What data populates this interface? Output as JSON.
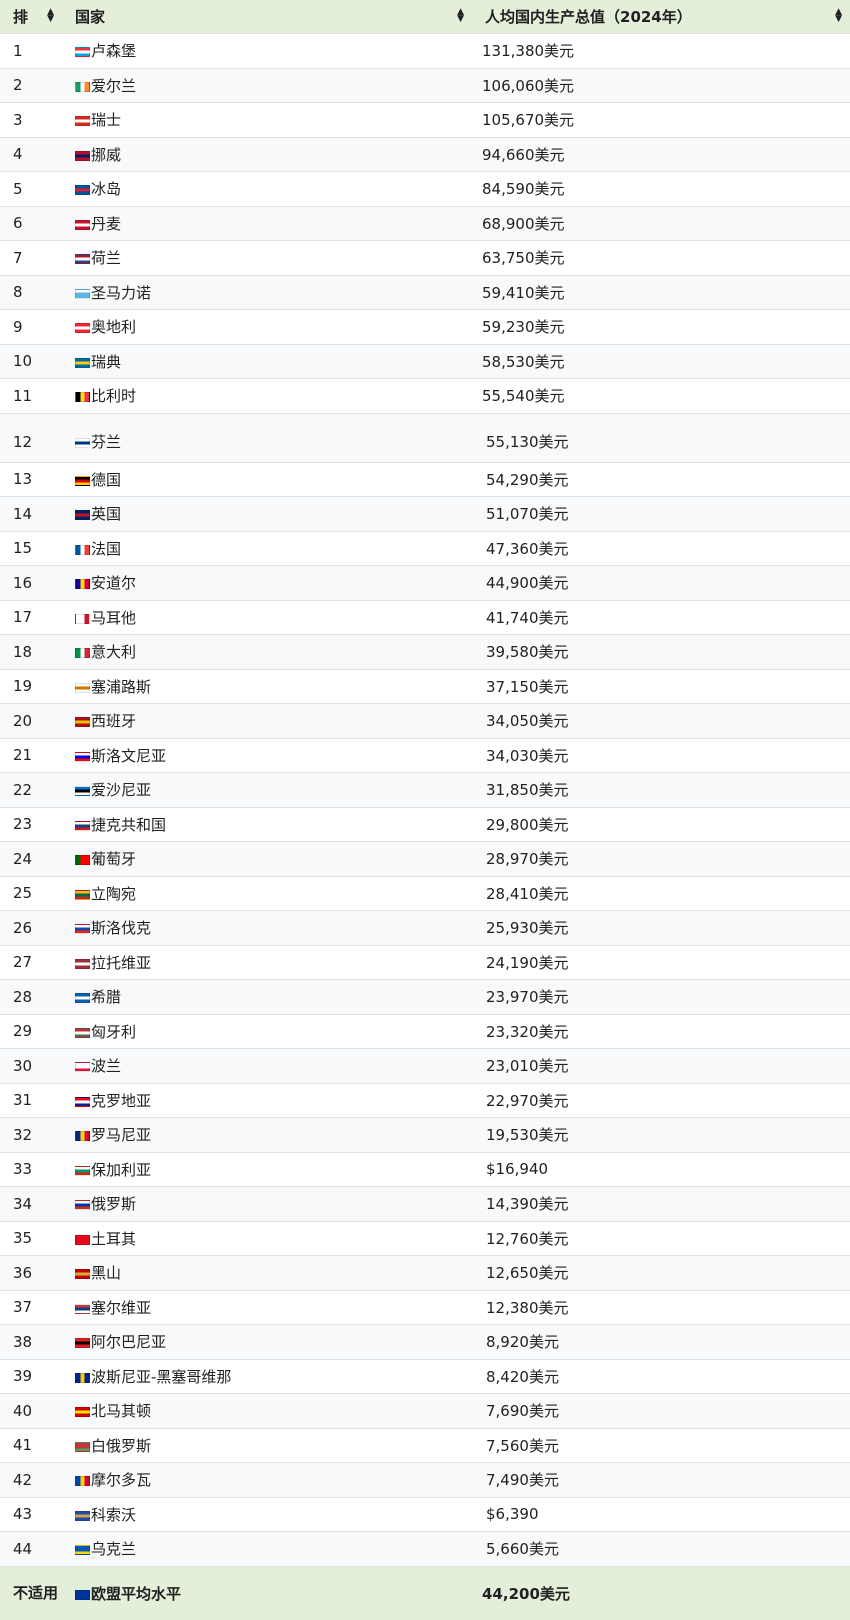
{
  "header": {
    "rank": "排",
    "country": "国家",
    "gdp": "人均国内生产总值（2024年）"
  },
  "rows": [
    {
      "rank": "1",
      "country": "卢森堡",
      "gdp": "131,380美元",
      "flag": [
        "#ef3340",
        "#ffffff",
        "#00a3e0"
      ]
    },
    {
      "rank": "2",
      "country": "爱尔兰",
      "gdp": "106,060美元",
      "flag": [
        "#169b62",
        "#ffffff",
        "#ff883e"
      ],
      "vertical": true
    },
    {
      "rank": "3",
      "country": "瑞士",
      "gdp": "105,670美元",
      "flag": [
        "#d52b1e",
        "#ffffff",
        "#d52b1e"
      ]
    },
    {
      "rank": "4",
      "country": "挪威",
      "gdp": "94,660美元",
      "flag": [
        "#ba0c2f",
        "#00205b",
        "#ba0c2f"
      ]
    },
    {
      "rank": "5",
      "country": "冰岛",
      "gdp": "84,590美元",
      "flag": [
        "#02529c",
        "#dc1e35",
        "#02529c"
      ]
    },
    {
      "rank": "6",
      "country": "丹麦",
      "gdp": "68,900美元",
      "flag": [
        "#c8102e",
        "#ffffff",
        "#c8102e"
      ]
    },
    {
      "rank": "7",
      "country": "荷兰",
      "gdp": "63,750美元",
      "flag": [
        "#ae1c28",
        "#ffffff",
        "#21468b"
      ]
    },
    {
      "rank": "8",
      "country": "圣马力诺",
      "gdp": "59,410美元",
      "flag": [
        "#ffffff",
        "#5eb6e4",
        "#5eb6e4"
      ]
    },
    {
      "rank": "9",
      "country": "奥地利",
      "gdp": "59,230美元",
      "flag": [
        "#ed2939",
        "#ffffff",
        "#ed2939"
      ]
    },
    {
      "rank": "10",
      "country": "瑞典",
      "gdp": "58,530美元",
      "flag": [
        "#006aa7",
        "#fecc00",
        "#006aa7"
      ]
    },
    {
      "rank": "11",
      "country": "比利时",
      "gdp": "55,540美元",
      "flag": [
        "#000000",
        "#fdda24",
        "#ef3340"
      ],
      "vertical": true
    },
    {
      "rank": "12",
      "country": "芬兰",
      "gdp": "55,130美元",
      "flag": [
        "#ffffff",
        "#003580",
        "#ffffff"
      ]
    },
    {
      "rank": "13",
      "country": "德国",
      "gdp": "54,290美元",
      "flag": [
        "#000000",
        "#dd0000",
        "#ffce00"
      ]
    },
    {
      "rank": "14",
      "country": "英国",
      "gdp": "51,070美元",
      "flag": [
        "#012169",
        "#c8102e",
        "#012169"
      ]
    },
    {
      "rank": "15",
      "country": "法国",
      "gdp": "47,360美元",
      "flag": [
        "#0055a4",
        "#ffffff",
        "#ef4135"
      ],
      "vertical": true
    },
    {
      "rank": "16",
      "country": "安道尔",
      "gdp": "44,900美元",
      "flag": [
        "#10069f",
        "#fedd00",
        "#d50032"
      ],
      "vertical": true
    },
    {
      "rank": "17",
      "country": "马耳他",
      "gdp": "41,740美元",
      "flag": [
        "#ffffff",
        "#ffffff",
        "#cf142b"
      ],
      "vertical": true
    },
    {
      "rank": "18",
      "country": "意大利",
      "gdp": "39,580美元",
      "flag": [
        "#009246",
        "#ffffff",
        "#ce2b37"
      ],
      "vertical": true
    },
    {
      "rank": "19",
      "country": "塞浦路斯",
      "gdp": "37,150美元",
      "flag": [
        "#ffffff",
        "#d57800",
        "#ffffff"
      ]
    },
    {
      "rank": "20",
      "country": "西班牙",
      "gdp": "34,050美元",
      "flag": [
        "#aa151b",
        "#f1bf00",
        "#aa151b"
      ]
    },
    {
      "rank": "21",
      "country": "斯洛文尼亚",
      "gdp": "34,030美元",
      "flag": [
        "#ffffff",
        "#0000ff",
        "#ff0000"
      ]
    },
    {
      "rank": "22",
      "country": "爱沙尼亚",
      "gdp": "31,850美元",
      "flag": [
        "#0072ce",
        "#000000",
        "#ffffff"
      ]
    },
    {
      "rank": "23",
      "country": "捷克共和国",
      "gdp": "29,800美元",
      "flag": [
        "#ffffff",
        "#11457e",
        "#d7141a"
      ]
    },
    {
      "rank": "24",
      "country": "葡萄牙",
      "gdp": "28,970美元",
      "flag": [
        "#006600",
        "#ff0000",
        "#ff0000"
      ],
      "vertical": true
    },
    {
      "rank": "25",
      "country": "立陶宛",
      "gdp": "28,410美元",
      "flag": [
        "#fdb913",
        "#006a44",
        "#c1272d"
      ]
    },
    {
      "rank": "26",
      "country": "斯洛伐克",
      "gdp": "25,930美元",
      "flag": [
        "#ffffff",
        "#0b4ea2",
        "#ee1c25"
      ]
    },
    {
      "rank": "27",
      "country": "拉托维亚",
      "gdp": "24,190美元",
      "flag": [
        "#9e3039",
        "#ffffff",
        "#9e3039"
      ]
    },
    {
      "rank": "28",
      "country": "希腊",
      "gdp": "23,970美元",
      "flag": [
        "#0d5eaf",
        "#ffffff",
        "#0d5eaf"
      ]
    },
    {
      "rank": "29",
      "country": "匈牙利",
      "gdp": "23,320美元",
      "flag": [
        "#ce2939",
        "#ffffff",
        "#477050"
      ]
    },
    {
      "rank": "30",
      "country": "波兰",
      "gdp": "23,010美元",
      "flag": [
        "#ffffff",
        "#ffffff",
        "#dc143c"
      ]
    },
    {
      "rank": "31",
      "country": "克罗地亚",
      "gdp": "22,970美元",
      "flag": [
        "#ff0000",
        "#ffffff",
        "#171796"
      ]
    },
    {
      "rank": "32",
      "country": "罗马尼亚",
      "gdp": "19,530美元",
      "flag": [
        "#002b7f",
        "#fcd116",
        "#ce1126"
      ],
      "vertical": true
    },
    {
      "rank": "33",
      "country": "保加利亚",
      "gdp": "$16,940",
      "flag": [
        "#ffffff",
        "#00966e",
        "#d62612"
      ]
    },
    {
      "rank": "34",
      "country": "俄罗斯",
      "gdp": "14,390美元",
      "flag": [
        "#ffffff",
        "#0039a6",
        "#d52b1e"
      ]
    },
    {
      "rank": "35",
      "country": "土耳其",
      "gdp": "12,760美元",
      "flag": [
        "#e30a17",
        "#e30a17",
        "#e30a17"
      ]
    },
    {
      "rank": "36",
      "country": "黑山",
      "gdp": "12,650美元",
      "flag": [
        "#c40308",
        "#d4af37",
        "#c40308"
      ]
    },
    {
      "rank": "37",
      "country": "塞尔维亚",
      "gdp": "12,380美元",
      "flag": [
        "#c6363c",
        "#0c4076",
        "#ffffff"
      ]
    },
    {
      "rank": "38",
      "country": "阿尔巴尼亚",
      "gdp": "8,920美元",
      "flag": [
        "#e41e20",
        "#000000",
        "#e41e20"
      ]
    },
    {
      "rank": "39",
      "country": "波斯尼亚-黑塞哥维那",
      "gdp": "8,420美元",
      "flag": [
        "#002395",
        "#fecb00",
        "#002395"
      ],
      "vertical": true
    },
    {
      "rank": "40",
      "country": "北马其顿",
      "gdp": "7,690美元",
      "flag": [
        "#d20000",
        "#ffe600",
        "#d20000"
      ]
    },
    {
      "rank": "41",
      "country": "白俄罗斯",
      "gdp": "7,560美元",
      "flag": [
        "#c8313e",
        "#c8313e",
        "#4aa657"
      ]
    },
    {
      "rank": "42",
      "country": "摩尔多瓦",
      "gdp": "7,490美元",
      "flag": [
        "#0046ae",
        "#ffd200",
        "#cc092f"
      ],
      "vertical": true
    },
    {
      "rank": "43",
      "country": "科索沃",
      "gdp": "$6,390",
      "flag": [
        "#244aa5",
        "#d0a650",
        "#244aa5"
      ]
    },
    {
      "rank": "44",
      "country": "乌克兰",
      "gdp": "5,660美元",
      "flag": [
        "#0057b7",
        "#0057b7",
        "#ffd700"
      ]
    }
  ],
  "total": {
    "rank": "不适用",
    "country": "欧盟平均水平",
    "gdp": "44,200美元",
    "flag": [
      "#003399",
      "#003399",
      "#003399"
    ]
  },
  "colors": {
    "header_bg": "#e3efd8",
    "stripe_bg": "#f8f9fa",
    "border": "#dfe2e5"
  }
}
